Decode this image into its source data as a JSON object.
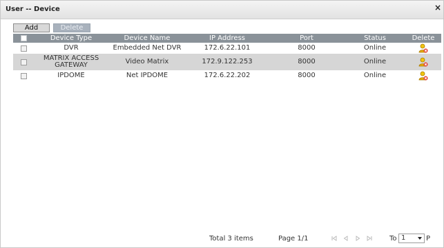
{
  "window": {
    "title": "User -- Device",
    "close_glyph": "×"
  },
  "toolbar": {
    "add_label": "Add",
    "delete_label": "Delete"
  },
  "table": {
    "columns": [
      "Device Type",
      "Device Name",
      "IP Address",
      "Port",
      "Status",
      "Delete"
    ],
    "rows": [
      {
        "type": "DVR",
        "name": "Embedded Net DVR",
        "ip": "172.6.22.101",
        "port": "8000",
        "status": "Online",
        "delete_icon": "user-delete-icon"
      },
      {
        "type": "MATRIX ACCESS GATEWAY",
        "name": "Video Matrix",
        "ip": "172.9.122.253",
        "port": "8000",
        "status": "Online",
        "delete_icon": "user-delete-icon"
      },
      {
        "type": "IPDOME",
        "name": "Net IPDOME",
        "ip": "172.6.22.202",
        "port": "8000",
        "status": "Online",
        "delete_icon": "user-delete-icon"
      }
    ]
  },
  "pager": {
    "total_label": "Total  3  items",
    "page_label": "Page  1/1",
    "to_label": "To",
    "page_value": "1",
    "page_suffix": "P"
  },
  "colors": {
    "header_bg": "#8a9299",
    "selected_row_bg": "#d6d6d6",
    "delete_button_bg": "#a9b2bd"
  }
}
